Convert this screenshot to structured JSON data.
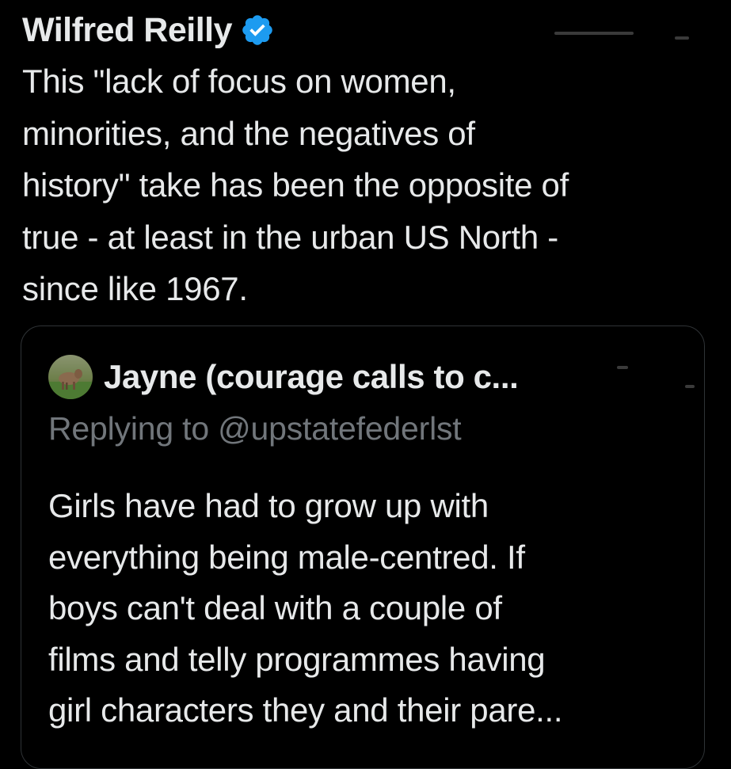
{
  "tweet": {
    "author_name": "Wilfred Reilly",
    "verified_icon": "verified-badge-icon",
    "text": "This \"lack of focus on women,\nminorities, and the negatives of\nhistory\" take has been the opposite of\ntrue - at least in the urban US North -\nsince like 1967."
  },
  "quote": {
    "author_name": "Jayne (courage calls to c...",
    "avatar_icon": "avatar-deer-photo",
    "replying_to": "Replying to @upstatefederlst",
    "text": "Girls have had to grow up with\neverything being male-centred. If\nboys can't deal with a couple of\nfilms and telly programmes having\ngirl characters they and their pare..."
  },
  "colors": {
    "background": "#000000",
    "primary_text": "#e7e9ea",
    "secondary_text": "#71767b",
    "card_border": "#2f3336",
    "verified_blue": "#1d9bf0"
  }
}
